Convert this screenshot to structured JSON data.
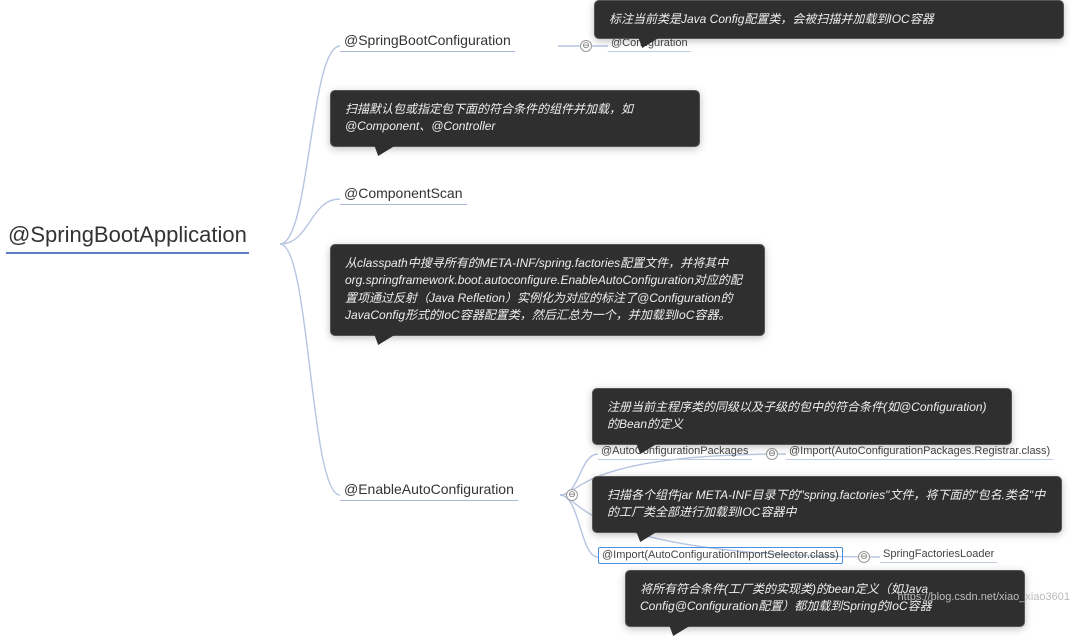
{
  "root": "@SpringBootApplication",
  "nodes": {
    "n1": "@SpringBootConfiguration",
    "n1a": "@Configuration",
    "n2": "@ComponentScan",
    "n3": "@EnableAutoConfiguration",
    "n3a": "@AutoConfigurationPackages",
    "n3b": "@Import(AutoConfigurationPackages.Registrar.class)",
    "n3c": "@Import(AutoConfigurationImportSelector.class)",
    "n3d": "SpringFactoriesLoader"
  },
  "notes": {
    "note1": "标注当前类是Java Config配置类，会被扫描并加载到IOC容器",
    "note2": "扫描默认包或指定包下面的符合条件的组件并加载，如@Component、@Controller",
    "note3": "从classpath中搜寻所有的META-INF/spring.factories配置文件，并将其中\norg.springframework.boot.autoconfigure.EnableAutoConfiguration对应的配置项通过反射（Java Refletion）实例化为对应的标注了@Configuration的JavaConfig形式的IoC容器配置类，然后汇总为一个，并加载到IoC容器。",
    "note4": "注册当前主程序类的同级以及子级的包中的符合条件(如@Configuration)的Bean的定义",
    "note5": "扫描各个组件jar META-INF目录下的\"spring.factories\"文件，将下面的\"包名.类名\"中的工厂类全部进行加载到IOC容器中",
    "note6": "将所有符合条件(工厂类的实现类)的bean定义（如Java Config@Configuration配置）都加载到Spring的IoC容器"
  },
  "watermark": "https://blog.csdn.net/xiao_xiao3601"
}
